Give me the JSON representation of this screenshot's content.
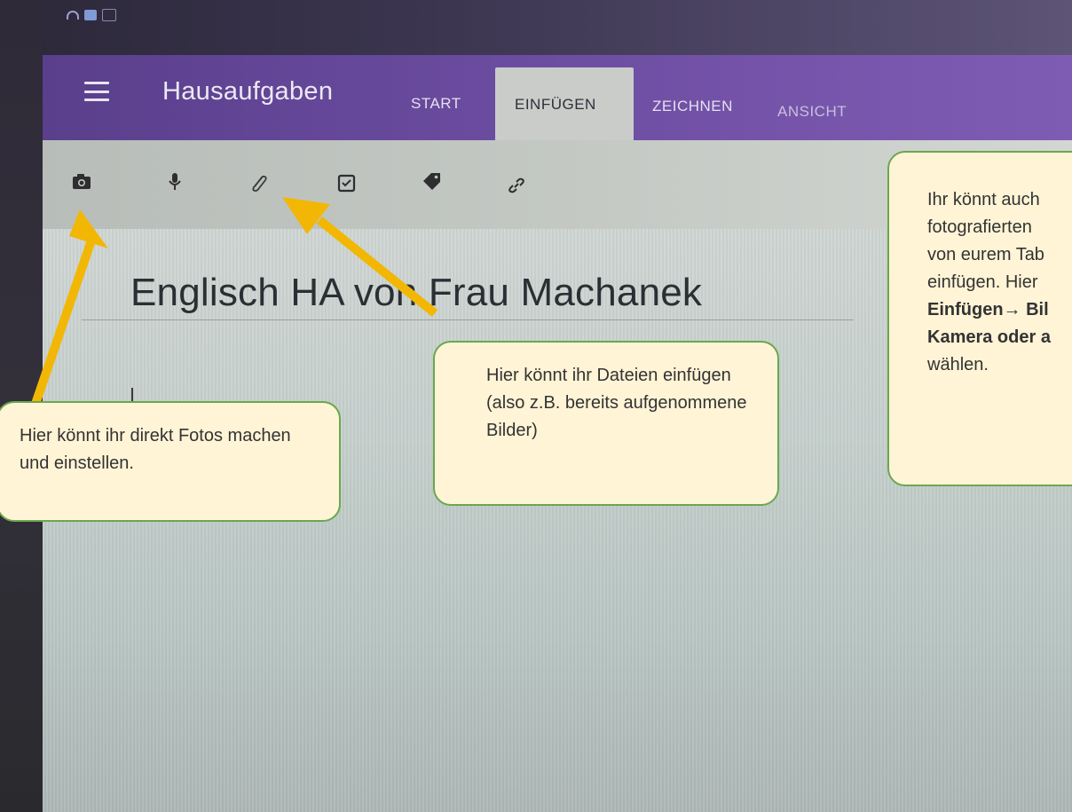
{
  "app": {
    "title": "Hausaufgaben"
  },
  "tabs": [
    {
      "label": "START"
    },
    {
      "label": "EINFÜGEN",
      "active": true
    },
    {
      "label": "ZEICHNEN"
    },
    {
      "label": "ANSICHT"
    }
  ],
  "ribbon": {
    "icons": [
      "camera-icon",
      "microphone-icon",
      "paperclip-icon",
      "checkbox-icon",
      "tag-icon",
      "link-icon"
    ]
  },
  "page": {
    "title": "Englisch HA von Frau Machanek"
  },
  "callouts": {
    "photo": "Hier könnt ihr direkt Fotos machen und einstellen.",
    "files": "Hier könnt ihr Dateien einfügen (also z.B. bereits aufgenommene Bilder)",
    "side": {
      "line1": "Ihr könnt auch",
      "line2": "fotografierten",
      "line3": "von eurem Tab",
      "line4": "einfügen. Hier",
      "line5_bold": "Einfügen",
      "line5_arrow": "→ Bil",
      "line6_bold": "Kamera oder a",
      "line7": "wählen."
    }
  },
  "colors": {
    "header": "#6b4ca0",
    "arrow": "#f2b705",
    "callout_bg": "#fff4d6",
    "callout_border": "#6aa84f"
  }
}
